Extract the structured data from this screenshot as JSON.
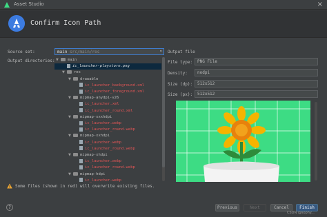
{
  "window": {
    "title": "Asset Studio"
  },
  "header": {
    "title": "Confirm Icon Path"
  },
  "source_set": {
    "label": "Source set:",
    "value": "main",
    "path": "src/main/res"
  },
  "output_directories_label": "Output directories:",
  "tree": [
    {
      "name": "main",
      "level": 0,
      "type": "folder",
      "expanded": true,
      "style": "normal"
    },
    {
      "name": "ic_launcher-playstore.png",
      "level": 1,
      "type": "file",
      "style": "italic"
    },
    {
      "name": "res",
      "level": 1,
      "type": "folder",
      "expanded": true,
      "style": "normal"
    },
    {
      "name": "drawable",
      "level": 2,
      "type": "folder",
      "expanded": true,
      "style": "normal"
    },
    {
      "name": "ic_launcher_background.xml",
      "level": 3,
      "type": "file",
      "style": "red"
    },
    {
      "name": "ic_launcher_foreground.xml",
      "level": 3,
      "type": "file",
      "style": "red"
    },
    {
      "name": "mipmap-anydpi-v26",
      "level": 2,
      "type": "folder",
      "expanded": true,
      "style": "normal"
    },
    {
      "name": "ic_launcher.xml",
      "level": 3,
      "type": "file",
      "style": "red"
    },
    {
      "name": "ic_launcher_round.xml",
      "level": 3,
      "type": "file",
      "style": "red"
    },
    {
      "name": "mipmap-xxxhdpi",
      "level": 2,
      "type": "folder",
      "expanded": true,
      "style": "normal"
    },
    {
      "name": "ic_launcher.webp",
      "level": 3,
      "type": "file",
      "style": "red"
    },
    {
      "name": "ic_launcher_round.webp",
      "level": 3,
      "type": "file",
      "style": "red"
    },
    {
      "name": "mipmap-xxhdpi",
      "level": 2,
      "type": "folder",
      "expanded": true,
      "style": "normal"
    },
    {
      "name": "ic_launcher.webp",
      "level": 3,
      "type": "file",
      "style": "red"
    },
    {
      "name": "ic_launcher_round.webp",
      "level": 3,
      "type": "file",
      "style": "red"
    },
    {
      "name": "mipmap-xhdpi",
      "level": 2,
      "type": "folder",
      "expanded": true,
      "style": "normal"
    },
    {
      "name": "ic_launcher.webp",
      "level": 3,
      "type": "file",
      "style": "red"
    },
    {
      "name": "ic_launcher_round.webp",
      "level": 3,
      "type": "file",
      "style": "red"
    },
    {
      "name": "mipmap-hdpi",
      "level": 2,
      "type": "folder",
      "expanded": true,
      "style": "normal"
    },
    {
      "name": "ic_launcher.webp",
      "level": 3,
      "type": "file",
      "style": "red"
    }
  ],
  "output_file": {
    "title": "Output file",
    "file_type_label": "File type:",
    "file_type": "PNG File",
    "density_label": "Density:",
    "density": "nodpi",
    "size_dp_label": "Size (dp):",
    "size_dp": "512x512",
    "size_px_label": "Size (px):",
    "size_px": "512x512"
  },
  "warning": "Some files (shown in red) will overwrite existing files.",
  "buttons": {
    "help": "?",
    "previous": "Previous",
    "next": "Next",
    "cancel": "Cancel",
    "finish": "Finish"
  },
  "watermark": "CSDN @sophy...",
  "colors": {
    "accent": "#3f7ed0",
    "overwrite_red": "#e05555",
    "preview_bg": "#3ddc84"
  }
}
